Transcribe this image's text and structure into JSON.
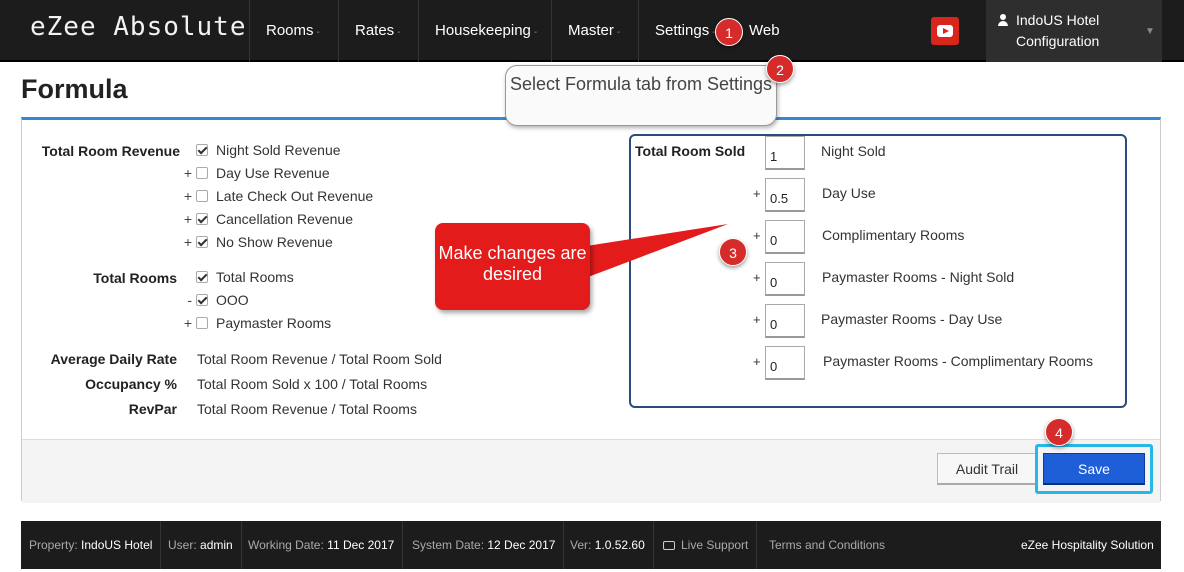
{
  "app": {
    "brand": "eZee Absolute"
  },
  "nav": {
    "items": [
      {
        "label": "Rooms",
        "caret": "-"
      },
      {
        "label": "Rates",
        "caret": "-"
      },
      {
        "label": "Housekeeping",
        "caret": "-"
      },
      {
        "label": "Master",
        "caret": "-"
      },
      {
        "label": "Settings",
        "caret": "-"
      },
      {
        "label": "Web",
        "caret": ""
      }
    ],
    "user": {
      "name": "IndoUS Hotel",
      "role": "Configuration"
    }
  },
  "page": {
    "title": "Formula"
  },
  "left": {
    "total_room_revenue": {
      "label": "Total Room Revenue",
      "items": [
        {
          "op": "",
          "label": "Night Sold Revenue",
          "checked": true
        },
        {
          "op": "+",
          "label": "Day Use Revenue",
          "checked": false
        },
        {
          "op": "+",
          "label": "Late Check Out Revenue",
          "checked": false
        },
        {
          "op": "+",
          "label": "Cancellation Revenue",
          "checked": true
        },
        {
          "op": "+",
          "label": "No Show Revenue",
          "checked": true
        }
      ]
    },
    "total_rooms": {
      "label": "Total Rooms",
      "items": [
        {
          "op": "",
          "label": "Total Rooms",
          "checked": true
        },
        {
          "op": "-",
          "label": "OOO",
          "checked": true
        },
        {
          "op": "+",
          "label": "Paymaster Rooms",
          "checked": false
        }
      ]
    },
    "formulas": [
      {
        "label": "Average Daily Rate",
        "value": "Total Room Revenue / Total Room Sold"
      },
      {
        "label": "Occupancy %",
        "value": "Total Room Sold x 100 / Total Rooms"
      },
      {
        "label": "RevPar",
        "value": "Total Room Revenue / Total Rooms"
      }
    ]
  },
  "right": {
    "label": "Total Room Sold",
    "items": [
      {
        "op": "",
        "value": "1",
        "label": "Night Sold"
      },
      {
        "op": "+",
        "value": "0.5",
        "label": "Day Use"
      },
      {
        "op": "+",
        "value": "0",
        "label": "Complimentary Rooms"
      },
      {
        "op": "+",
        "value": "0",
        "label": "Paymaster Rooms - Night Sold"
      },
      {
        "op": "+",
        "value": "0",
        "label": "Paymaster Rooms - Day Use"
      },
      {
        "op": "+",
        "value": "0",
        "label": "Paymaster Rooms - Complimentary Rooms"
      }
    ]
  },
  "buttons": {
    "audit": "Audit Trail",
    "save": "Save"
  },
  "annotations": {
    "badges": [
      "1",
      "2",
      "3",
      "4"
    ],
    "tip_settings": "Select Formula tab from Settings",
    "tip_changes": "Make changes are desired"
  },
  "footer": {
    "property_label": "Property:",
    "property": "IndoUS Hotel",
    "user_label": "User:",
    "user": "admin",
    "working_label": "Working Date:",
    "working": "11 Dec 2017",
    "system_label": "System Date:",
    "system": "12 Dec 2017",
    "ver_label": "Ver:",
    "ver": "1.0.52.60",
    "live_support": "Live Support",
    "terms": "Terms and Conditions",
    "company": "eZee Hospitality Solution"
  },
  "colors": {
    "accent": "#3a86d6",
    "save": "#1e5fd8",
    "badge": "#d62b2b",
    "tip_red": "#e31b1b",
    "highlight": "#28b8e6"
  },
  "icons": [
    "user-icon",
    "youtube-icon",
    "chat-icon",
    "checkbox-check-icon"
  ]
}
